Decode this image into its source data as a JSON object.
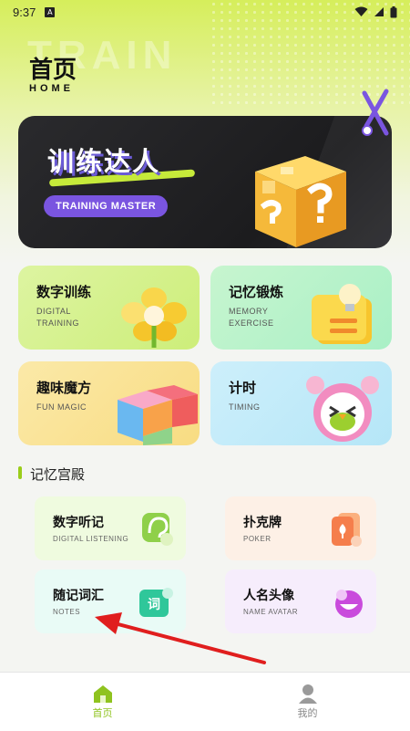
{
  "status_bar": {
    "time": "9:37",
    "badge": "A"
  },
  "header": {
    "watermark": "TRAIN",
    "title": "首页",
    "subtitle": "HOME"
  },
  "banner": {
    "title": "训练达人",
    "pill": "TRAINING MASTER"
  },
  "cards": [
    {
      "title": "数字训练",
      "sub": "DIGITAL TRAINING",
      "art": "flower-icon"
    },
    {
      "title": "记忆锻炼",
      "sub": "MEMORY EXERCISE",
      "art": "notebook-bulb-icon"
    },
    {
      "title": "趣味魔方",
      "sub": "FUN MAGIC",
      "art": "cube-blocks-icon"
    },
    {
      "title": "计时",
      "sub": "TIMING",
      "art": "alarm-clock-bird-icon"
    }
  ],
  "section": {
    "title": "记忆宫殿"
  },
  "memory_cards": [
    {
      "title": "数字听记",
      "sub": "DIGITAL LISTENING",
      "icon": "ear-icon"
    },
    {
      "title": "扑克牌",
      "sub": "POKER",
      "icon": "poker-card-icon"
    },
    {
      "title": "随记词汇",
      "sub": "NOTES",
      "icon": "word-icon",
      "icon_text": "词"
    },
    {
      "title": "人名头像",
      "sub": "NAME AVATAR",
      "icon": "avatar-icon"
    }
  ],
  "tabbar": {
    "items": [
      {
        "label": "首页",
        "icon": "home-icon",
        "active": true
      },
      {
        "label": "我的",
        "icon": "user-icon",
        "active": false
      }
    ]
  },
  "colors": {
    "accent": "#8fc31f",
    "banner_bg": "#1f1f21",
    "pill": "#7a55e0",
    "arrow": "#e01e1e"
  }
}
